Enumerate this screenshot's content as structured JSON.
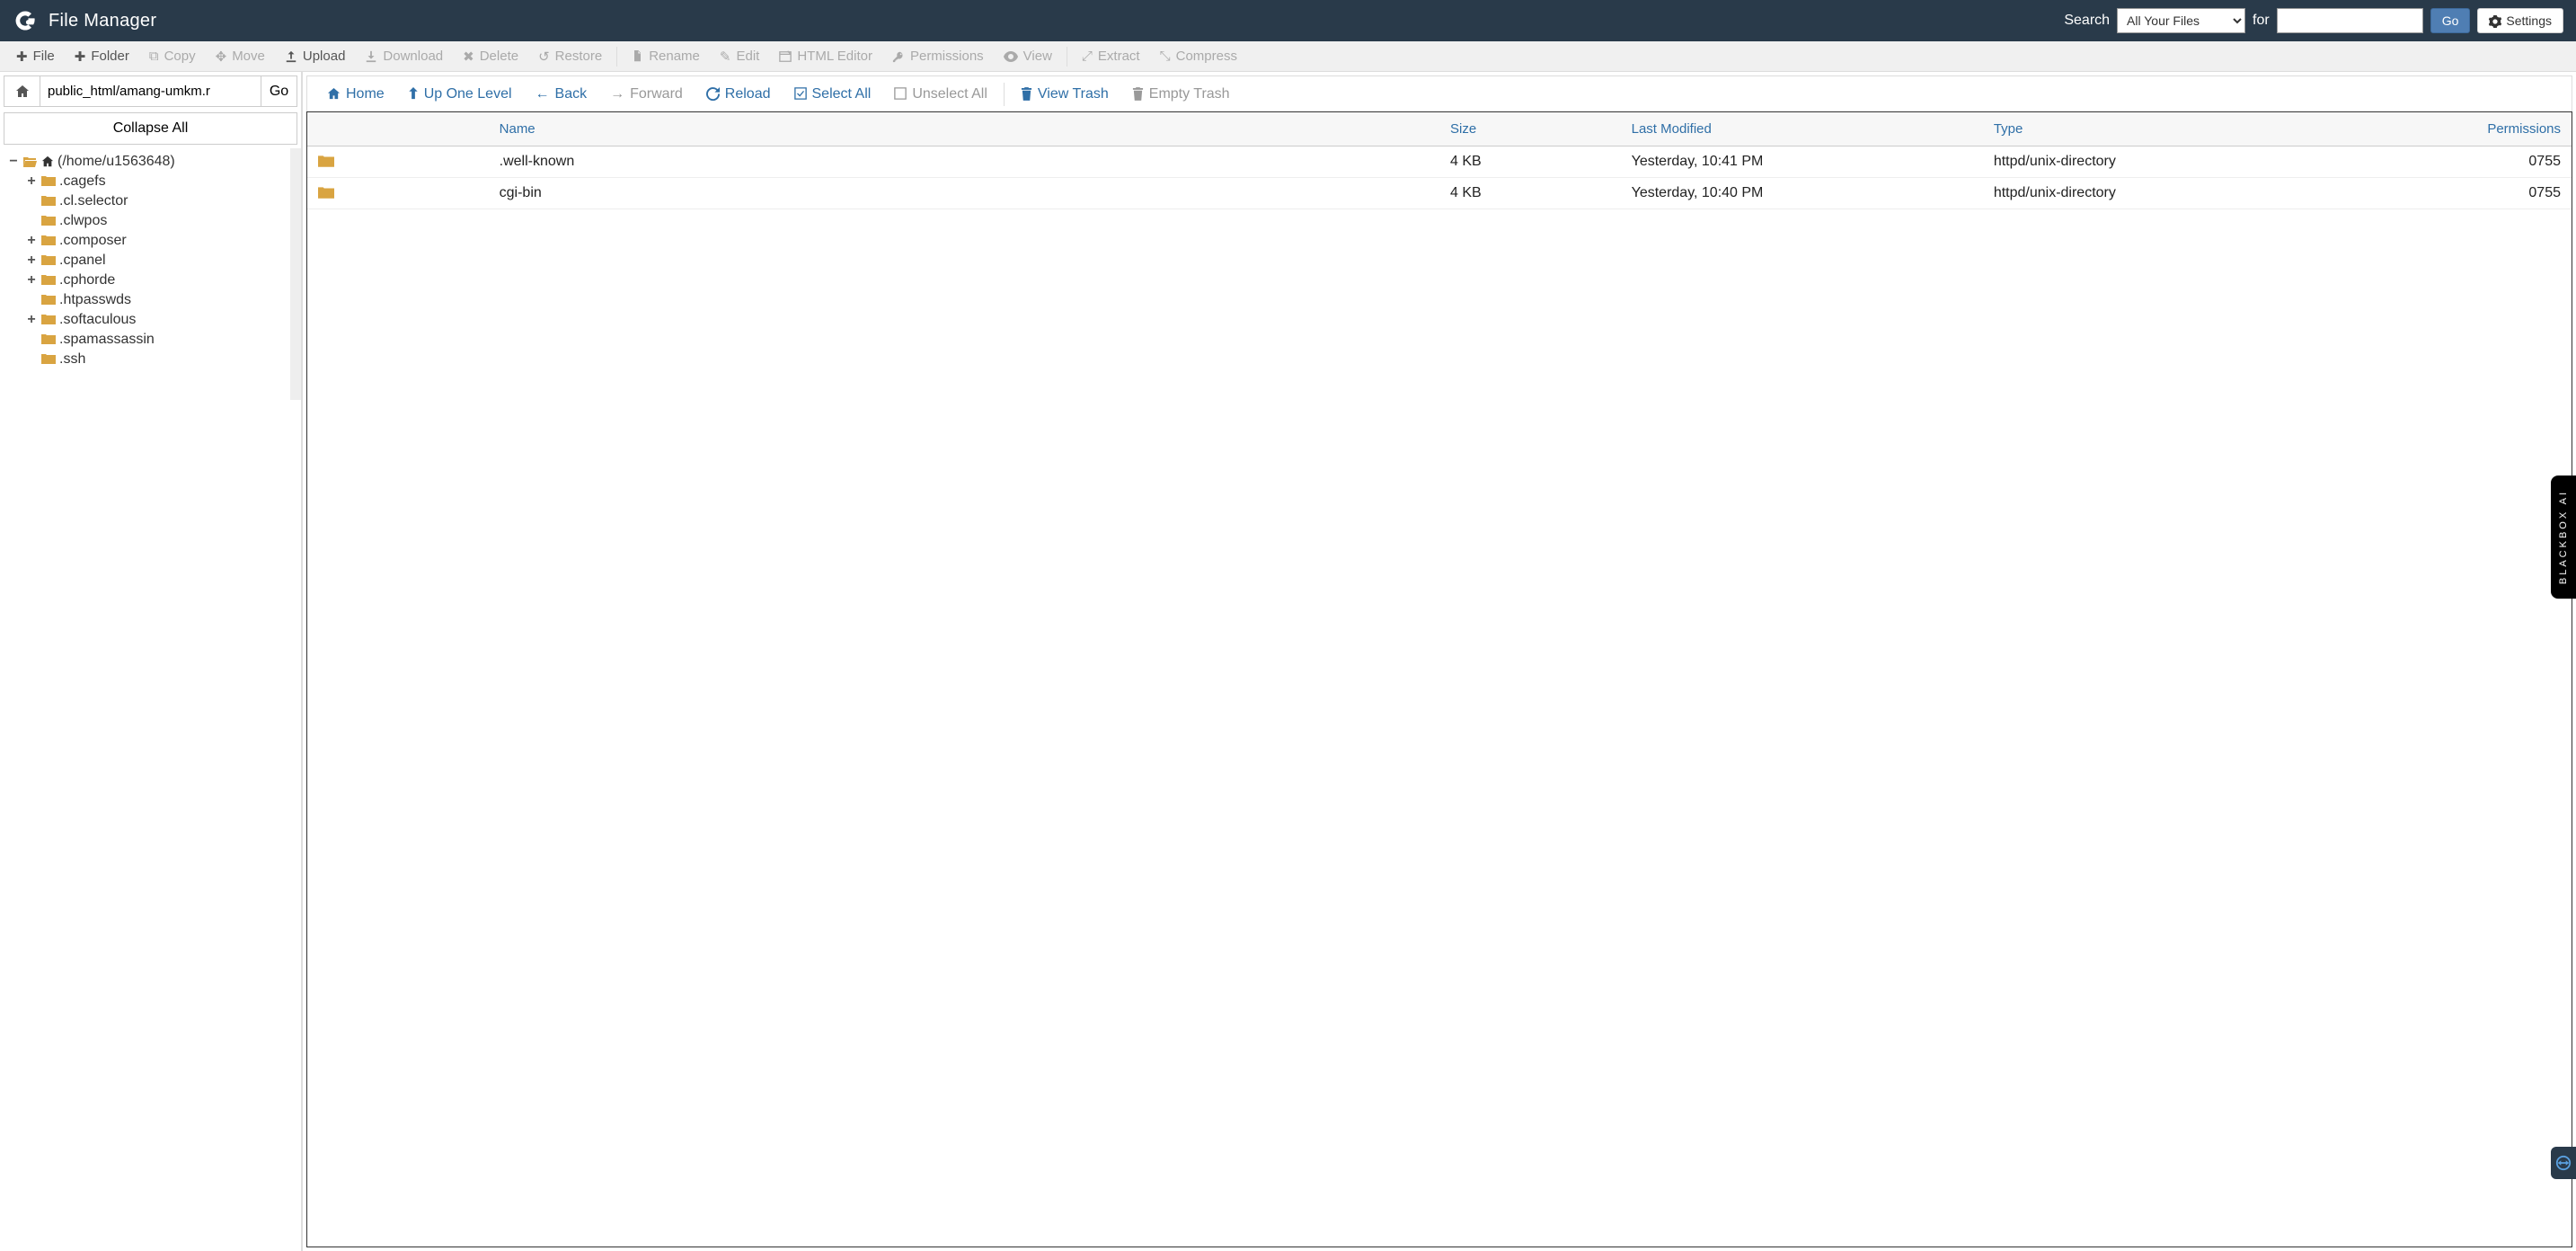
{
  "header": {
    "title": "File Manager",
    "search_label": "Search",
    "for_label": "for",
    "scope_selected": "All Your Files",
    "go_label": "Go",
    "settings_label": "Settings"
  },
  "toolbar": {
    "file": "File",
    "folder": "Folder",
    "copy": "Copy",
    "move": "Move",
    "upload": "Upload",
    "download": "Download",
    "delete": "Delete",
    "restore": "Restore",
    "rename": "Rename",
    "edit": "Edit",
    "html_editor": "HTML Editor",
    "permissions": "Permissions",
    "view": "View",
    "extract": "Extract",
    "compress": "Compress"
  },
  "sidebar": {
    "path_value": "public_html/amang-umkm.r",
    "go_label": "Go",
    "collapse_all": "Collapse All",
    "root_label": "(/home/u1563648)",
    "tree": [
      {
        "name": ".cagefs",
        "expandable": true
      },
      {
        "name": ".cl.selector",
        "expandable": false
      },
      {
        "name": ".clwpos",
        "expandable": false
      },
      {
        "name": ".composer",
        "expandable": true
      },
      {
        "name": ".cpanel",
        "expandable": true
      },
      {
        "name": ".cphorde",
        "expandable": true
      },
      {
        "name": ".htpasswds",
        "expandable": false
      },
      {
        "name": ".softaculous",
        "expandable": true
      },
      {
        "name": ".spamassassin",
        "expandable": false
      },
      {
        "name": ".ssh",
        "expandable": false
      }
    ]
  },
  "nav": {
    "home": "Home",
    "up": "Up One Level",
    "back": "Back",
    "forward": "Forward",
    "reload": "Reload",
    "select_all": "Select All",
    "unselect_all": "Unselect All",
    "view_trash": "View Trash",
    "empty_trash": "Empty Trash"
  },
  "table": {
    "headers": {
      "name": "Name",
      "size": "Size",
      "modified": "Last Modified",
      "type": "Type",
      "permissions": "Permissions"
    },
    "rows": [
      {
        "name": ".well-known",
        "size": "4 KB",
        "modified": "Yesterday, 10:41 PM",
        "type": "httpd/unix-directory",
        "permissions": "0755"
      },
      {
        "name": "cgi-bin",
        "size": "4 KB",
        "modified": "Yesterday, 10:40 PM",
        "type": "httpd/unix-directory",
        "permissions": "0755"
      }
    ]
  },
  "side_tab": "BLACKBOX AI"
}
